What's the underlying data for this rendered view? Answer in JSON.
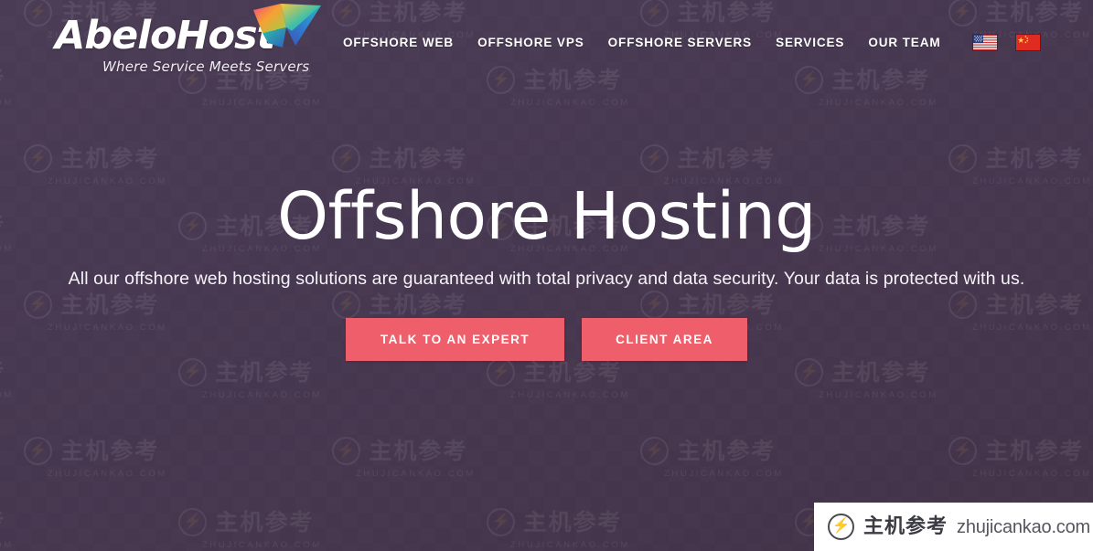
{
  "site": {
    "background_color": "#473851",
    "accent_color": "#ef5f6b"
  },
  "header": {
    "brand_name": "AbeloHost",
    "brand_tagline": "Where Service Meets Servers",
    "logo_mark": "origami-bird-logo",
    "nav": [
      {
        "label": "OFFSHORE WEB",
        "name": "nav-offshore-web"
      },
      {
        "label": "OFFSHORE VPS",
        "name": "nav-offshore-vps"
      },
      {
        "label": "OFFSHORE SERVERS",
        "name": "nav-offshore-servers"
      },
      {
        "label": "SERVICES",
        "name": "nav-services"
      },
      {
        "label": "OUR TEAM",
        "name": "nav-our-team"
      }
    ],
    "language_flags": [
      {
        "name": "flag-us-icon",
        "title": "English"
      },
      {
        "name": "flag-cn-icon",
        "title": "中文"
      }
    ]
  },
  "hero": {
    "title": "Offshore Hosting",
    "subtitle": "All our offshore web hosting solutions are guaranteed with total privacy and data security. Your data is protected with us.",
    "buttons": [
      {
        "label": "TALK TO AN EXPERT",
        "name": "talk-to-an-expert-button"
      },
      {
        "label": "CLIENT AREA",
        "name": "client-area-button"
      }
    ]
  },
  "watermark": {
    "cn_text": "主机参考",
    "url_text": "ZHUJICANKAO.COM",
    "bolt_glyph": "⚡"
  },
  "badge": {
    "cn_text": "主机参考",
    "url_text": "zhujicankao.com",
    "bolt_glyph": "⚡"
  }
}
